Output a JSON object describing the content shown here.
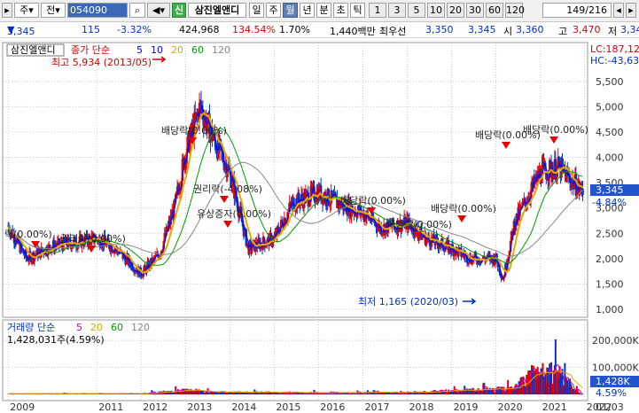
{
  "toolbar": {
    "market": "주",
    "board": "전",
    "code": "054090",
    "search_icon": "search-icon",
    "sound_icon": "speaker-icon",
    "new_label": "신",
    "stock_name": "삼진엘앤디",
    "periods": [
      "일",
      "주",
      "월",
      "년",
      "분",
      "초",
      "틱"
    ],
    "active_period": "월",
    "intervals": [
      "1",
      "3",
      "5",
      "10",
      "20",
      "30",
      "60",
      "120"
    ],
    "page": "149/216"
  },
  "quote": {
    "price": "3,345",
    "change": "115",
    "change_pct": "-3.32%",
    "volume": "424,968",
    "volume_ratio": "134.54%",
    "turnover": "1.70%",
    "amount": "1,440백만",
    "priority_label": "최우선",
    "ask": "3,350",
    "bid": "3,345",
    "open_label": "시",
    "open": "3,360",
    "high_label": "고",
    "high": "3,470",
    "low_label": "저",
    "low": "3,34"
  },
  "price_panel": {
    "stock_label": "삼진엘앤디",
    "legend_main": "종가 단순",
    "ma_periods": [
      "5",
      "10",
      "20",
      "60",
      "120"
    ],
    "lc_label": "LC:187,12",
    "hc_label": "HC:-43,63",
    "max_note": "최고 5,934 (2013/05)",
    "min_note": "최저 1,165 (2020/03)",
    "current_price": "3,345",
    "current_pct": "-4.84%",
    "y_ticks": [
      "5,500",
      "5,000",
      "4,500",
      "4,000",
      "3,500",
      "3,000",
      "2,500",
      "2,000",
      "1,500",
      "1,000"
    ],
    "annotations": [
      "락(0.00%)",
      "권리락(0.00%)",
      "배당락(0.00%)",
      "권리락(-4.08%)",
      "유상증자(0.00%)",
      "배당락(0.00%)",
      "배당락(0.00%)",
      "배당락(0.00%)",
      "배당락(0.00%)",
      "배당락(0.00%)"
    ]
  },
  "volume_panel": {
    "legend_main": "거래량 단순",
    "ma_periods": [
      "5",
      "20",
      "60",
      "120"
    ],
    "current": "1,428,031주(4.59%)",
    "y_ticks": [
      "200,000K",
      "100,000K"
    ],
    "current_tag": "1,428K",
    "current_pct": "4.59%"
  },
  "x_axis": {
    "labels": [
      "2009",
      "2011",
      "2012",
      "2013",
      "2014",
      "2015",
      "2016",
      "2017",
      "2018",
      "2019",
      "2020",
      "2021",
      "2022"
    ],
    "date_label": "01/03"
  },
  "colors": {
    "up": "#e60000",
    "down": "#0033cc",
    "ma5": "#0000ff",
    "ma10": "#0000ff",
    "ma20": "#e6a800",
    "ma60": "#009900",
    "ma120": "#888888"
  },
  "chart_data": {
    "type": "candlestick",
    "price_series": [
      {
        "name": "종가",
        "points": [
          [
            "2009-01",
            2650
          ],
          [
            "2009-06",
            2000
          ],
          [
            "2010-01",
            2250
          ],
          [
            "2010-06",
            2300
          ],
          [
            "2011-01",
            2400
          ],
          [
            "2011-06",
            2200
          ],
          [
            "2012-01",
            1700
          ],
          [
            "2012-06",
            2100
          ],
          [
            "2012-10",
            3000
          ],
          [
            "2013-01",
            4100
          ],
          [
            "2013-05",
            5000
          ],
          [
            "2013-09",
            4300
          ],
          [
            "2014-01",
            3700
          ],
          [
            "2014-06",
            2200
          ],
          [
            "2015-01",
            2400
          ],
          [
            "2015-06",
            3100
          ],
          [
            "2016-01",
            3300
          ],
          [
            "2016-06",
            3100
          ],
          [
            "2017-01",
            2900
          ],
          [
            "2017-06",
            2600
          ],
          [
            "2018-01",
            2700
          ],
          [
            "2018-06",
            2400
          ],
          [
            "2019-01",
            2200
          ],
          [
            "2019-06",
            2000
          ],
          [
            "2020-01",
            2000
          ],
          [
            "2020-03",
            1600
          ],
          [
            "2020-06",
            2700
          ],
          [
            "2021-01",
            3700
          ],
          [
            "2021-06",
            3800
          ],
          [
            "2021-12",
            3345
          ]
        ]
      }
    ],
    "volume_series": [
      {
        "name": "거래량",
        "points": [
          [
            "2009-01",
            4
          ],
          [
            "2012-01",
            6
          ],
          [
            "2013-01",
            30
          ],
          [
            "2014-01",
            15
          ],
          [
            "2016-01",
            12
          ],
          [
            "2018-01",
            14
          ],
          [
            "2020-06",
            40
          ],
          [
            "2021-01",
            200
          ],
          [
            "2021-06",
            150
          ],
          [
            "2021-12",
            1.4
          ]
        ]
      }
    ],
    "ylim": [
      1000,
      5900
    ],
    "max": {
      "value": 5934,
      "date": "2013/05"
    },
    "min": {
      "value": 1165,
      "date": "2020/03"
    }
  }
}
